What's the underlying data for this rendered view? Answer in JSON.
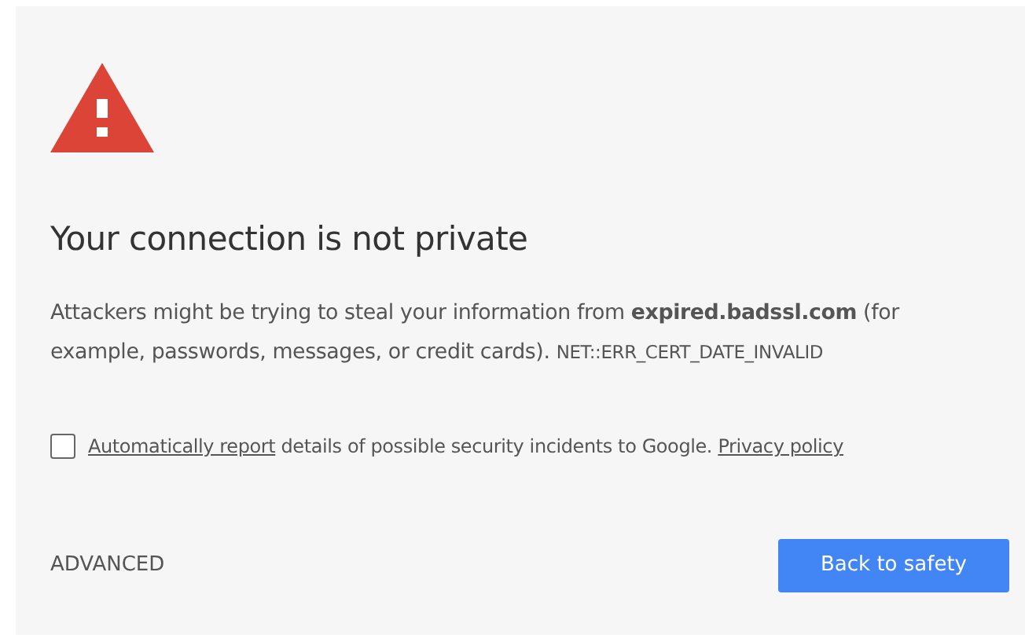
{
  "heading": "Your connection is not private",
  "description": "Attackers might be trying to steal your information from **expired.badssl.com** (for example, passwords, messages, or credit cards).",
  "error_code": "NET::ERR_CERT_DATE_INVALID",
  "report": {
    "checked": false,
    "link": "Automatically report",
    "text": "details of possible security incidents to Google.",
    "policy_link": "Privacy policy"
  },
  "buttons": [
    {
      "kind": "link",
      "label": "ADVANCED"
    },
    {
      "kind": "primary",
      "label": "Back to safety"
    }
  ]
}
